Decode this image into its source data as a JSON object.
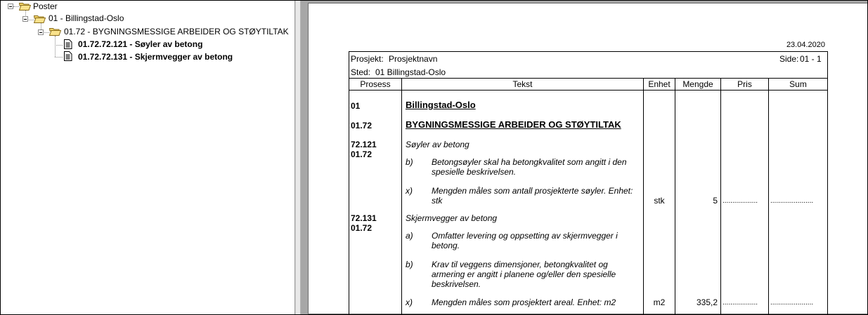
{
  "tree": {
    "root": "Poster",
    "level1": "01 - Billingstad-Oslo",
    "level2": "01.72 - BYGNINGSMESSIGE ARBEIDER OG STØYTILTAK",
    "items": [
      {
        "label": "01.72.72.121 - Søyler av betong"
      },
      {
        "label": "01.72.72.131 - Skjermvegger av betong"
      }
    ]
  },
  "report": {
    "date": "23.04.2020",
    "project_label": "Prosjekt:",
    "project_value": "Prosjektnavn",
    "side_label": "Side:",
    "side_value": "01 - 1",
    "place_label": "Sted:",
    "place_value": "01 Billingstad-Oslo",
    "columns": [
      "Prosess",
      "Tekst",
      "Enhet",
      "Mengde",
      "Pris",
      "Sum"
    ],
    "sections": [
      {
        "code": "01",
        "title": "Billingstad-Oslo"
      },
      {
        "code": "01.72",
        "title": "BYGNINGSMESSIGE ARBEIDER OG STØYTILTAK"
      }
    ],
    "posts": [
      {
        "code1": "72.121",
        "code2": "01.72",
        "title": "Søyler av betong",
        "lines": [
          {
            "key": "b)",
            "text": "Betongsøyler skal ha betongkvalitet som angitt i den spesielle beskrivelsen."
          },
          {
            "key": "x)",
            "text": "Mengden måles som antall prosjekterte søyler. Enhet: stk"
          }
        ],
        "unit": "stk",
        "qty": "5",
        "price": "..................",
        "sum": "......................"
      },
      {
        "code1": "72.131",
        "code2": "01.72",
        "title": "Skjermvegger av betong",
        "lines": [
          {
            "key": "a)",
            "text": "Omfatter levering og oppsetting av skjermvegger i betong."
          },
          {
            "key": "b)",
            "text": "Krav til veggens dimensjoner, betongkvalitet og armering er angitt i planene og/eller den spesielle beskrivelsen."
          },
          {
            "key": "x)",
            "text": "Mengden måles som prosjektert areal. Enhet: m2"
          }
        ],
        "unit": "m2",
        "qty": "335,2",
        "price": "..................",
        "sum": "......................"
      }
    ]
  },
  "icons": {
    "folder": "folder-open-icon",
    "document": "document-icon",
    "expander": "collapse-minus-icon"
  },
  "colors": {
    "folder": "#f4d56a",
    "page_bg": "#a7a7a7"
  }
}
